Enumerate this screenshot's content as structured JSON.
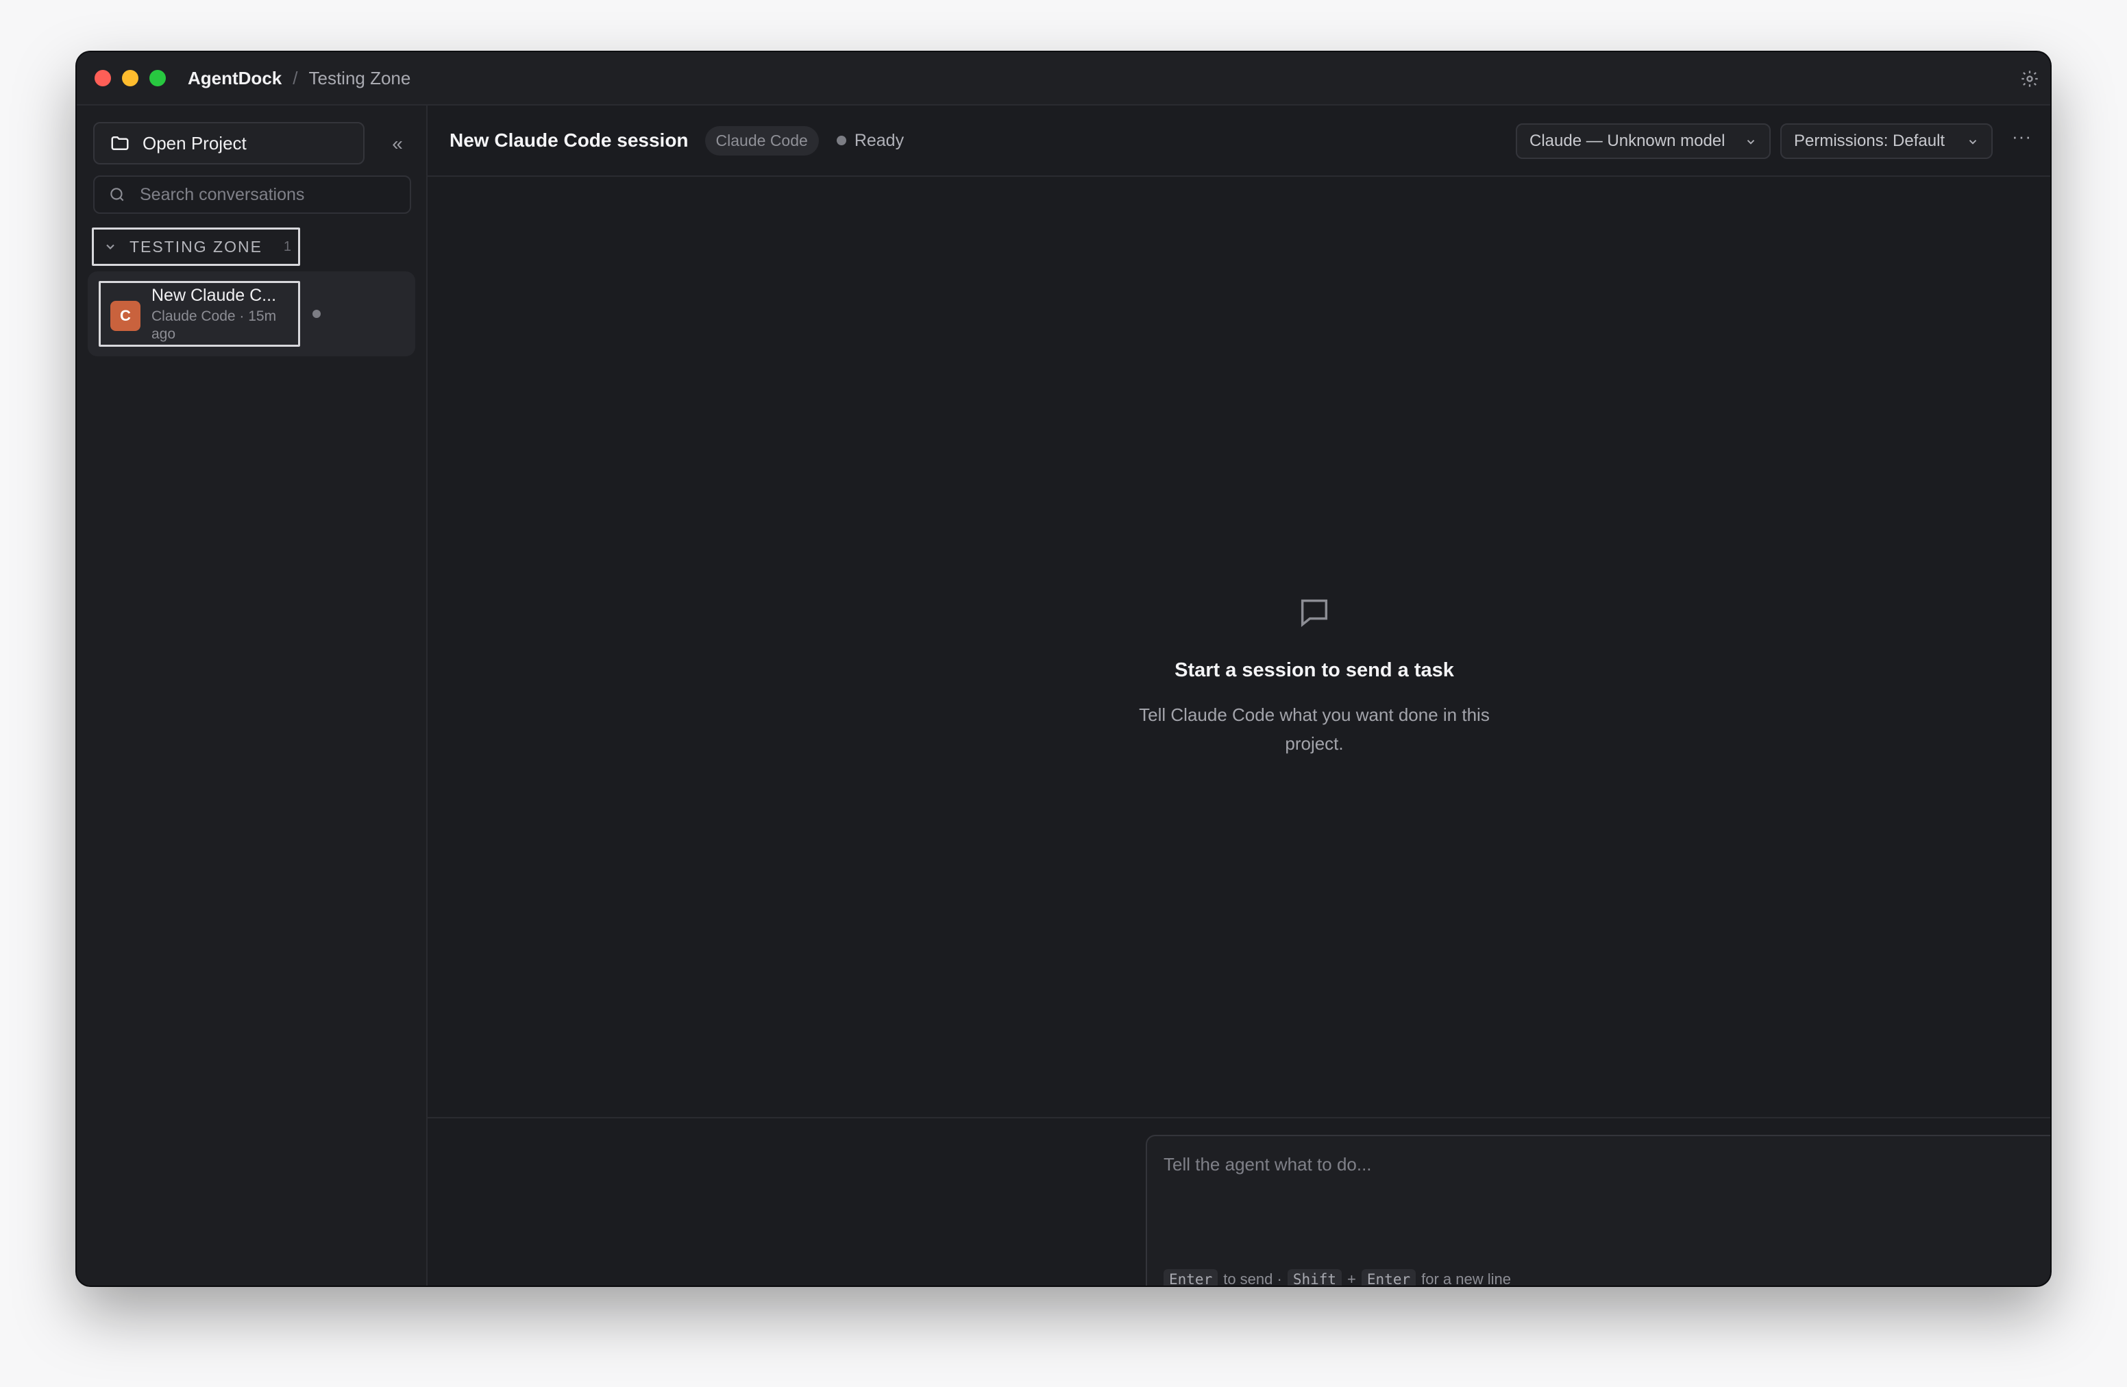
{
  "window": {
    "app_title": "AgentDock",
    "breadcrumb_separator": "/",
    "breadcrumb": "Testing Zone"
  },
  "sidebar": {
    "open_project_label": "Open Project",
    "collapse_label": "«",
    "search_placeholder": "Search conversations",
    "group": {
      "label": "TESTING ZONE",
      "count": "1"
    },
    "conversations": [
      {
        "avatar_letter": "C",
        "title": "New Claude C...",
        "meta": "Claude Code · 15m ago"
      }
    ]
  },
  "main": {
    "session_title": "New Claude Code session",
    "agent_badge": "Claude Code",
    "status": "Ready",
    "model_select": "Claude — Unknown model",
    "permissions_select": "Permissions: Default",
    "more_label": "···",
    "empty_state": {
      "title": "Start a session to send a task",
      "subtitle": "Tell Claude Code what you want done in this project."
    },
    "composer": {
      "placeholder": "Tell the agent what to do...",
      "hint": {
        "key_enter": "Enter",
        "to_send": "to send ·",
        "key_shift": "Shift",
        "plus": "+",
        "key_enter2": "Enter",
        "new_line": "for a new line"
      }
    }
  },
  "colors": {
    "window_bg": "#1b1c20",
    "avatar": "#c9623d",
    "send_button": "#3a4a7a",
    "traffic_red": "#fe5f57",
    "traffic_yellow": "#febc2e",
    "traffic_green": "#28c840"
  },
  "icons": [
    "settings-icon",
    "folder-icon",
    "search-icon",
    "chevron-down-icon",
    "message-square-icon",
    "arrow-up-icon"
  ]
}
